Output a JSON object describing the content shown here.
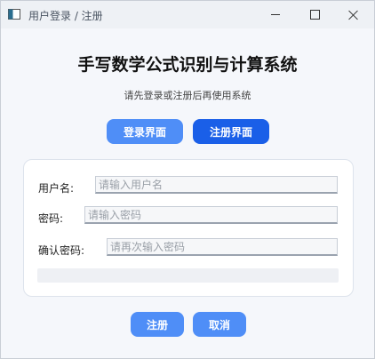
{
  "window": {
    "title": "用户登录 / 注册",
    "app_icon": "app-window-icon",
    "controls": [
      "minimize-icon",
      "maximize-icon",
      "close-icon"
    ]
  },
  "header": {
    "title": "手写数学公式识别与计算系统",
    "subtitle": "请先登录或注册后再使用系统"
  },
  "mode_switch": {
    "login_label": "登录界面",
    "register_label": "注册界面",
    "active": "register"
  },
  "form": {
    "username_label": "用户名:",
    "username_placeholder": "请输入用户名",
    "username_value": "",
    "password_label": "密码:",
    "password_placeholder": "请输入密码",
    "password_value": "",
    "confirm_label": "确认密码:",
    "confirm_placeholder": "请再次输入密码",
    "confirm_value": "",
    "status_message": ""
  },
  "actions": {
    "submit_label": "注册",
    "cancel_label": "取消"
  },
  "colors": {
    "primary": "#4f8ef7",
    "primary_active": "#1a5fe8",
    "background": "#f5f7fb",
    "card": "#ffffff"
  }
}
